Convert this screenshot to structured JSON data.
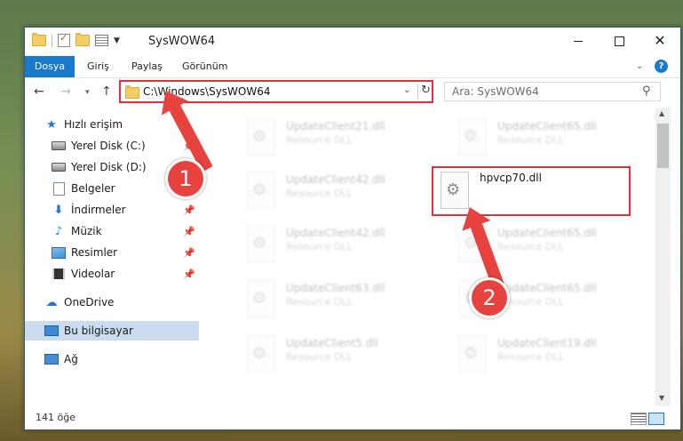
{
  "window": {
    "title": "SysWOW64"
  },
  "ribbon": {
    "tabs": [
      "Dosya",
      "Giriş",
      "Paylaş",
      "Görünüm"
    ]
  },
  "nav": {
    "address": "C:\\Windows\\SysWOW64",
    "search_placeholder": "Ara: SysWOW64"
  },
  "sidebar": {
    "items": [
      {
        "label": "Hızlı erişim",
        "icon": "star-icon"
      },
      {
        "label": "Yerel Disk (C:)",
        "icon": "drive-icon",
        "pinned": true
      },
      {
        "label": "Yerel Disk (D:)",
        "icon": "drive-icon"
      },
      {
        "label": "Belgeler",
        "icon": "documents-icon"
      },
      {
        "label": "İndirmeler",
        "icon": "download-icon",
        "pinned": true
      },
      {
        "label": "Müzik",
        "icon": "music-icon",
        "pinned": true
      },
      {
        "label": "Resimler",
        "icon": "pictures-icon",
        "pinned": true
      },
      {
        "label": "Videolar",
        "icon": "videos-icon",
        "pinned": true
      },
      {
        "label": "OneDrive",
        "icon": "cloud-icon"
      },
      {
        "label": "Bu bilgisayar",
        "icon": "computer-icon",
        "selected": true
      },
      {
        "label": "Ağ",
        "icon": "network-icon"
      }
    ]
  },
  "files": [
    {
      "name": "UpdateClient21.dll",
      "type": "Resource DLL",
      "faded": true
    },
    {
      "name": "UpdateClient65.dll",
      "type": "Resource DLL",
      "faded": true
    },
    {
      "name": "UpdateClient42.dll",
      "type": "Resource DLL",
      "faded": true
    },
    {
      "name": "hpvcp70.dll",
      "type": "",
      "faded": false,
      "highlighted": true
    },
    {
      "name": "UpdateClient42.dll",
      "type": "Resource DLL",
      "faded": true
    },
    {
      "name": "UpdateClient65.dll",
      "type": "Resource DLL",
      "faded": true
    },
    {
      "name": "UpdateClient63.dll",
      "type": "Resource DLL",
      "faded": true
    },
    {
      "name": "UpdateClient65.dll",
      "type": "Resource DLL",
      "faded": true
    },
    {
      "name": "UpdateClient5.dll",
      "type": "Resource DLL",
      "faded": true
    },
    {
      "name": "UpdateClient19.dll",
      "type": "Resource DLL",
      "faded": true
    }
  ],
  "status": {
    "count": "141 öğe"
  },
  "annotations": {
    "badge1": "1",
    "badge2": "2",
    "color": "#e8423f"
  }
}
